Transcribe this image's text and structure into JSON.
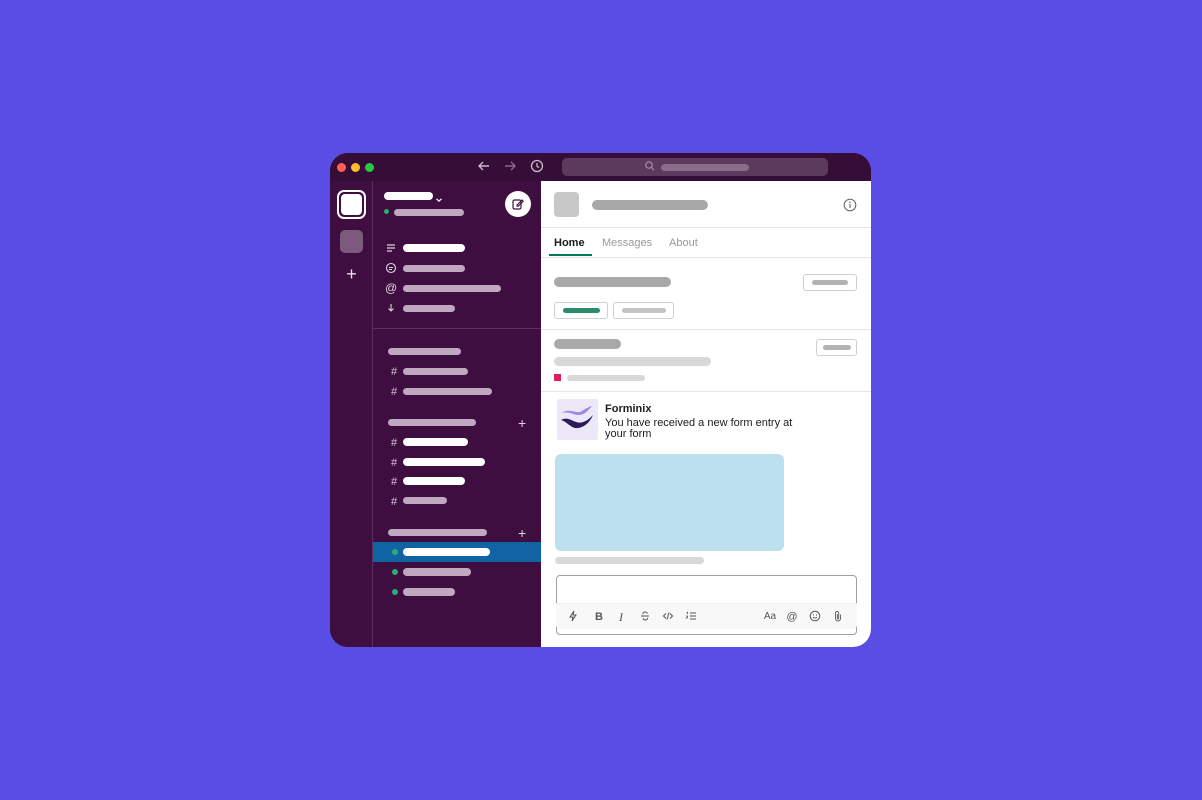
{
  "colors": {
    "background": "#5a4de6",
    "sidebar": "#3f0e40",
    "titlebar": "#350d36",
    "selected_row": "#1164a3",
    "accent_green": "#007a5a",
    "presence": "#2bac76"
  },
  "titlebar": {
    "traffic_lights": [
      "#ff5f57",
      "#febc2e",
      "#28c840"
    ],
    "icons": [
      "back-arrow-icon",
      "forward-arrow-icon",
      "history-icon",
      "search-icon"
    ]
  },
  "main": {
    "tabs": [
      {
        "label": "Home",
        "active": true
      },
      {
        "label": "Messages",
        "active": false
      },
      {
        "label": "About",
        "active": false
      }
    ],
    "message": {
      "sender": "Forminix",
      "text": "You have received a new form entry at your form"
    },
    "composer_tools": [
      "shortcuts-icon",
      "bold-icon",
      "italic-icon",
      "strikethrough-icon",
      "code-icon",
      "numbered-list-icon",
      "text-format-icon",
      "mention-icon",
      "emoji-icon",
      "attach-icon"
    ],
    "composer_labels": {
      "bold": "B",
      "italic": "I",
      "format": "Aa"
    }
  }
}
